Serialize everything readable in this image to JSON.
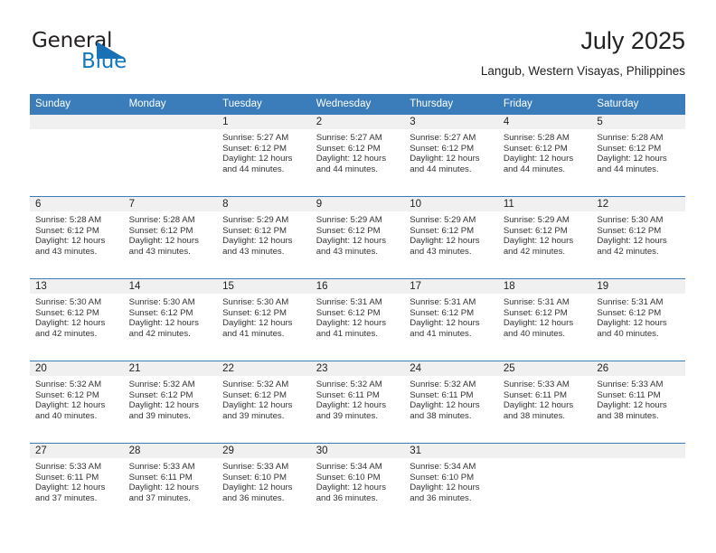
{
  "brand": {
    "name_part1": "General",
    "name_part2": "Blue",
    "triangle_icon": "triangle-icon",
    "colors": {
      "dark": "#231f20",
      "blue": "#1278be",
      "header_blue": "#3b7cba"
    }
  },
  "header": {
    "title": "July 2025",
    "subtitle": "Langub, Western Visayas, Philippines"
  },
  "calendar": {
    "weekday_headers": [
      "Sunday",
      "Monday",
      "Tuesday",
      "Wednesday",
      "Thursday",
      "Friday",
      "Saturday"
    ],
    "weeks": [
      [
        {
          "day": "",
          "empty": true
        },
        {
          "day": "",
          "empty": true
        },
        {
          "day": "1",
          "sunrise": "Sunrise: 5:27 AM",
          "sunset": "Sunset: 6:12 PM",
          "daylight_line1": "Daylight: 12 hours",
          "daylight_line2": "and 44 minutes."
        },
        {
          "day": "2",
          "sunrise": "Sunrise: 5:27 AM",
          "sunset": "Sunset: 6:12 PM",
          "daylight_line1": "Daylight: 12 hours",
          "daylight_line2": "and 44 minutes."
        },
        {
          "day": "3",
          "sunrise": "Sunrise: 5:27 AM",
          "sunset": "Sunset: 6:12 PM",
          "daylight_line1": "Daylight: 12 hours",
          "daylight_line2": "and 44 minutes."
        },
        {
          "day": "4",
          "sunrise": "Sunrise: 5:28 AM",
          "sunset": "Sunset: 6:12 PM",
          "daylight_line1": "Daylight: 12 hours",
          "daylight_line2": "and 44 minutes."
        },
        {
          "day": "5",
          "sunrise": "Sunrise: 5:28 AM",
          "sunset": "Sunset: 6:12 PM",
          "daylight_line1": "Daylight: 12 hours",
          "daylight_line2": "and 44 minutes."
        }
      ],
      [
        {
          "day": "6",
          "sunrise": "Sunrise: 5:28 AM",
          "sunset": "Sunset: 6:12 PM",
          "daylight_line1": "Daylight: 12 hours",
          "daylight_line2": "and 43 minutes."
        },
        {
          "day": "7",
          "sunrise": "Sunrise: 5:28 AM",
          "sunset": "Sunset: 6:12 PM",
          "daylight_line1": "Daylight: 12 hours",
          "daylight_line2": "and 43 minutes."
        },
        {
          "day": "8",
          "sunrise": "Sunrise: 5:29 AM",
          "sunset": "Sunset: 6:12 PM",
          "daylight_line1": "Daylight: 12 hours",
          "daylight_line2": "and 43 minutes."
        },
        {
          "day": "9",
          "sunrise": "Sunrise: 5:29 AM",
          "sunset": "Sunset: 6:12 PM",
          "daylight_line1": "Daylight: 12 hours",
          "daylight_line2": "and 43 minutes."
        },
        {
          "day": "10",
          "sunrise": "Sunrise: 5:29 AM",
          "sunset": "Sunset: 6:12 PM",
          "daylight_line1": "Daylight: 12 hours",
          "daylight_line2": "and 43 minutes."
        },
        {
          "day": "11",
          "sunrise": "Sunrise: 5:29 AM",
          "sunset": "Sunset: 6:12 PM",
          "daylight_line1": "Daylight: 12 hours",
          "daylight_line2": "and 42 minutes."
        },
        {
          "day": "12",
          "sunrise": "Sunrise: 5:30 AM",
          "sunset": "Sunset: 6:12 PM",
          "daylight_line1": "Daylight: 12 hours",
          "daylight_line2": "and 42 minutes."
        }
      ],
      [
        {
          "day": "13",
          "sunrise": "Sunrise: 5:30 AM",
          "sunset": "Sunset: 6:12 PM",
          "daylight_line1": "Daylight: 12 hours",
          "daylight_line2": "and 42 minutes."
        },
        {
          "day": "14",
          "sunrise": "Sunrise: 5:30 AM",
          "sunset": "Sunset: 6:12 PM",
          "daylight_line1": "Daylight: 12 hours",
          "daylight_line2": "and 42 minutes."
        },
        {
          "day": "15",
          "sunrise": "Sunrise: 5:30 AM",
          "sunset": "Sunset: 6:12 PM",
          "daylight_line1": "Daylight: 12 hours",
          "daylight_line2": "and 41 minutes."
        },
        {
          "day": "16",
          "sunrise": "Sunrise: 5:31 AM",
          "sunset": "Sunset: 6:12 PM",
          "daylight_line1": "Daylight: 12 hours",
          "daylight_line2": "and 41 minutes."
        },
        {
          "day": "17",
          "sunrise": "Sunrise: 5:31 AM",
          "sunset": "Sunset: 6:12 PM",
          "daylight_line1": "Daylight: 12 hours",
          "daylight_line2": "and 41 minutes."
        },
        {
          "day": "18",
          "sunrise": "Sunrise: 5:31 AM",
          "sunset": "Sunset: 6:12 PM",
          "daylight_line1": "Daylight: 12 hours",
          "daylight_line2": "and 40 minutes."
        },
        {
          "day": "19",
          "sunrise": "Sunrise: 5:31 AM",
          "sunset": "Sunset: 6:12 PM",
          "daylight_line1": "Daylight: 12 hours",
          "daylight_line2": "and 40 minutes."
        }
      ],
      [
        {
          "day": "20",
          "sunrise": "Sunrise: 5:32 AM",
          "sunset": "Sunset: 6:12 PM",
          "daylight_line1": "Daylight: 12 hours",
          "daylight_line2": "and 40 minutes."
        },
        {
          "day": "21",
          "sunrise": "Sunrise: 5:32 AM",
          "sunset": "Sunset: 6:12 PM",
          "daylight_line1": "Daylight: 12 hours",
          "daylight_line2": "and 39 minutes."
        },
        {
          "day": "22",
          "sunrise": "Sunrise: 5:32 AM",
          "sunset": "Sunset: 6:12 PM",
          "daylight_line1": "Daylight: 12 hours",
          "daylight_line2": "and 39 minutes."
        },
        {
          "day": "23",
          "sunrise": "Sunrise: 5:32 AM",
          "sunset": "Sunset: 6:11 PM",
          "daylight_line1": "Daylight: 12 hours",
          "daylight_line2": "and 39 minutes."
        },
        {
          "day": "24",
          "sunrise": "Sunrise: 5:32 AM",
          "sunset": "Sunset: 6:11 PM",
          "daylight_line1": "Daylight: 12 hours",
          "daylight_line2": "and 38 minutes."
        },
        {
          "day": "25",
          "sunrise": "Sunrise: 5:33 AM",
          "sunset": "Sunset: 6:11 PM",
          "daylight_line1": "Daylight: 12 hours",
          "daylight_line2": "and 38 minutes."
        },
        {
          "day": "26",
          "sunrise": "Sunrise: 5:33 AM",
          "sunset": "Sunset: 6:11 PM",
          "daylight_line1": "Daylight: 12 hours",
          "daylight_line2": "and 38 minutes."
        }
      ],
      [
        {
          "day": "27",
          "sunrise": "Sunrise: 5:33 AM",
          "sunset": "Sunset: 6:11 PM",
          "daylight_line1": "Daylight: 12 hours",
          "daylight_line2": "and 37 minutes."
        },
        {
          "day": "28",
          "sunrise": "Sunrise: 5:33 AM",
          "sunset": "Sunset: 6:11 PM",
          "daylight_line1": "Daylight: 12 hours",
          "daylight_line2": "and 37 minutes."
        },
        {
          "day": "29",
          "sunrise": "Sunrise: 5:33 AM",
          "sunset": "Sunset: 6:10 PM",
          "daylight_line1": "Daylight: 12 hours",
          "daylight_line2": "and 36 minutes."
        },
        {
          "day": "30",
          "sunrise": "Sunrise: 5:34 AM",
          "sunset": "Sunset: 6:10 PM",
          "daylight_line1": "Daylight: 12 hours",
          "daylight_line2": "and 36 minutes."
        },
        {
          "day": "31",
          "sunrise": "Sunrise: 5:34 AM",
          "sunset": "Sunset: 6:10 PM",
          "daylight_line1": "Daylight: 12 hours",
          "daylight_line2": "and 36 minutes."
        },
        {
          "day": "",
          "empty": true
        },
        {
          "day": "",
          "empty": true
        }
      ]
    ]
  }
}
